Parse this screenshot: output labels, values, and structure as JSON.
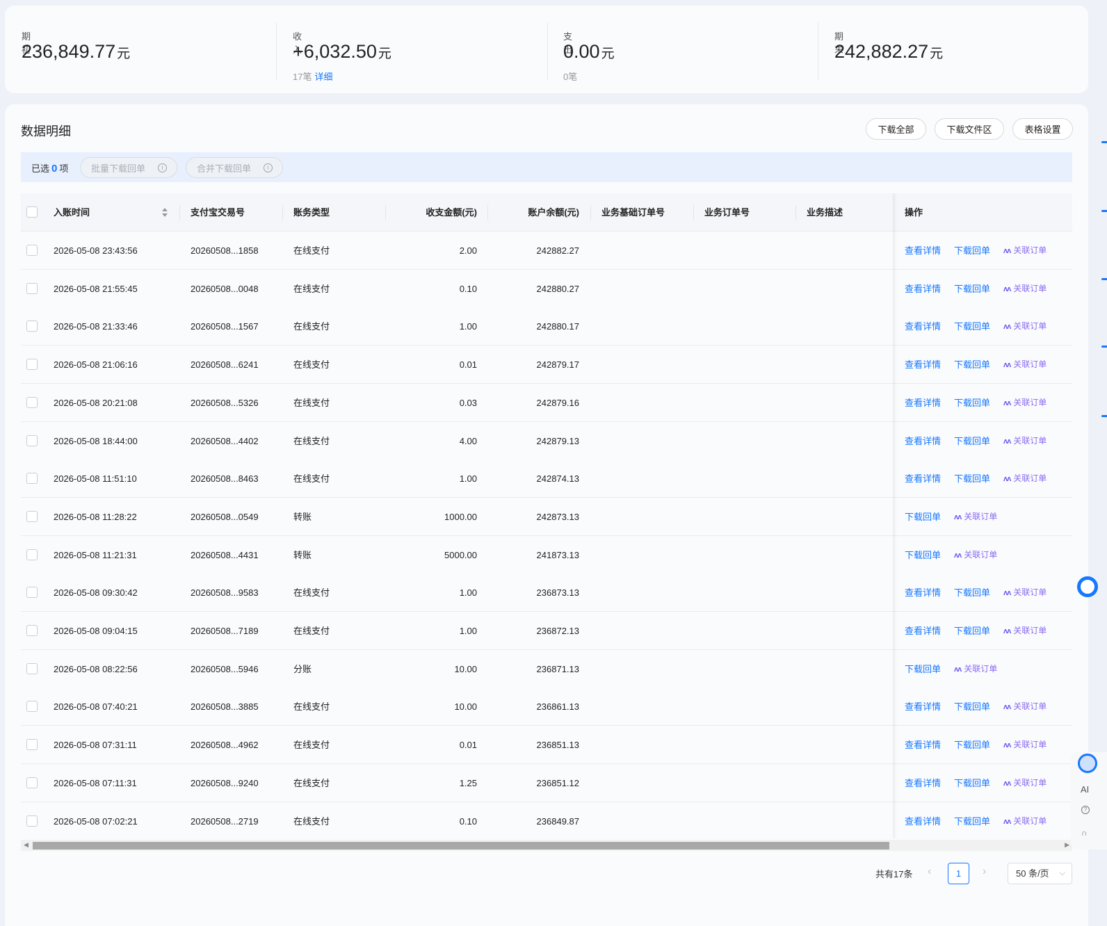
{
  "summary": {
    "opening": {
      "label": "期初",
      "value": "236,849.77",
      "unit": "元"
    },
    "income": {
      "label": "收入",
      "value": "+6,032.50",
      "unit": "元",
      "count": "17笔",
      "detail_link": "详细"
    },
    "expense": {
      "label": "支出",
      "value": "0.00",
      "unit": "元",
      "count": "0笔"
    },
    "closing": {
      "label": "期末",
      "value": "242,882.27",
      "unit": "元"
    }
  },
  "detail": {
    "title": "数据明细",
    "buttons": {
      "download_all": "下载全部",
      "download_area": "下载文件区",
      "table_settings": "表格设置"
    },
    "selection": {
      "prefix": "已选",
      "count": "0",
      "suffix": "项",
      "batch_download": "批量下载回单",
      "merge_download": "合并下载回单"
    }
  },
  "table": {
    "columns": {
      "time": "入账时间",
      "trade_no": "支付宝交易号",
      "type": "账务类型",
      "amount": "收支金额(元)",
      "balance": "账户余额(元)",
      "base_order": "业务基础订单号",
      "order": "业务订单号",
      "desc": "业务描述",
      "ops": "操作"
    },
    "op_labels": {
      "view": "查看详情",
      "download": "下载回单",
      "link_order": "关联订单",
      "ai_mark": "ʌʌ"
    },
    "rows": [
      {
        "time": "2026-05-08 23:43:56",
        "trade_no": "20260508...1858",
        "type": "在线支付",
        "amount": "2.00",
        "balance": "242882.27",
        "has_view": true
      },
      {
        "time": "2026-05-08 21:55:45",
        "trade_no": "20260508...0048",
        "type": "在线支付",
        "amount": "0.10",
        "balance": "242880.27",
        "has_view": true
      },
      {
        "time": "2026-05-08 21:33:46",
        "trade_no": "20260508...1567",
        "type": "在线支付",
        "amount": "1.00",
        "balance": "242880.17",
        "has_view": true
      },
      {
        "time": "2026-05-08 21:06:16",
        "trade_no": "20260508...6241",
        "type": "在线支付",
        "amount": "0.01",
        "balance": "242879.17",
        "has_view": true
      },
      {
        "time": "2026-05-08 20:21:08",
        "trade_no": "20260508...5326",
        "type": "在线支付",
        "amount": "0.03",
        "balance": "242879.16",
        "has_view": true
      },
      {
        "time": "2026-05-08 18:44:00",
        "trade_no": "20260508...4402",
        "type": "在线支付",
        "amount": "4.00",
        "balance": "242879.13",
        "has_view": true
      },
      {
        "time": "2026-05-08 11:51:10",
        "trade_no": "20260508...8463",
        "type": "在线支付",
        "amount": "1.00",
        "balance": "242874.13",
        "has_view": true
      },
      {
        "time": "2026-05-08 11:28:22",
        "trade_no": "20260508...0549",
        "type": "转账",
        "amount": "1000.00",
        "balance": "242873.13",
        "has_view": false
      },
      {
        "time": "2026-05-08 11:21:31",
        "trade_no": "20260508...4431",
        "type": "转账",
        "amount": "5000.00",
        "balance": "241873.13",
        "has_view": false
      },
      {
        "time": "2026-05-08 09:30:42",
        "trade_no": "20260508...9583",
        "type": "在线支付",
        "amount": "1.00",
        "balance": "236873.13",
        "has_view": true
      },
      {
        "time": "2026-05-08 09:04:15",
        "trade_no": "20260508...7189",
        "type": "在线支付",
        "amount": "1.00",
        "balance": "236872.13",
        "has_view": true
      },
      {
        "time": "2026-05-08 08:22:56",
        "trade_no": "20260508...5946",
        "type": "分账",
        "amount": "10.00",
        "balance": "236871.13",
        "has_view": false
      },
      {
        "time": "2026-05-08 07:40:21",
        "trade_no": "20260508...3885",
        "type": "在线支付",
        "amount": "10.00",
        "balance": "236861.13",
        "has_view": true
      },
      {
        "time": "2026-05-08 07:31:11",
        "trade_no": "20260508...4962",
        "type": "在线支付",
        "amount": "0.01",
        "balance": "236851.13",
        "has_view": true
      },
      {
        "time": "2026-05-08 07:11:31",
        "trade_no": "20260508...9240",
        "type": "在线支付",
        "amount": "1.25",
        "balance": "236851.12",
        "has_view": true
      },
      {
        "time": "2026-05-08 07:02:21",
        "trade_no": "20260508...2719",
        "type": "在线支付",
        "amount": "0.10",
        "balance": "236849.87",
        "has_view": true
      }
    ]
  },
  "pagination": {
    "total": "共有17条",
    "current_page": "1",
    "page_size": "50 条/页",
    "prev": "‹",
    "next": "›"
  },
  "side": {
    "ai_label": "AI"
  },
  "colors": {
    "accent": "#1677ff",
    "ai": "#8a6cf0"
  }
}
